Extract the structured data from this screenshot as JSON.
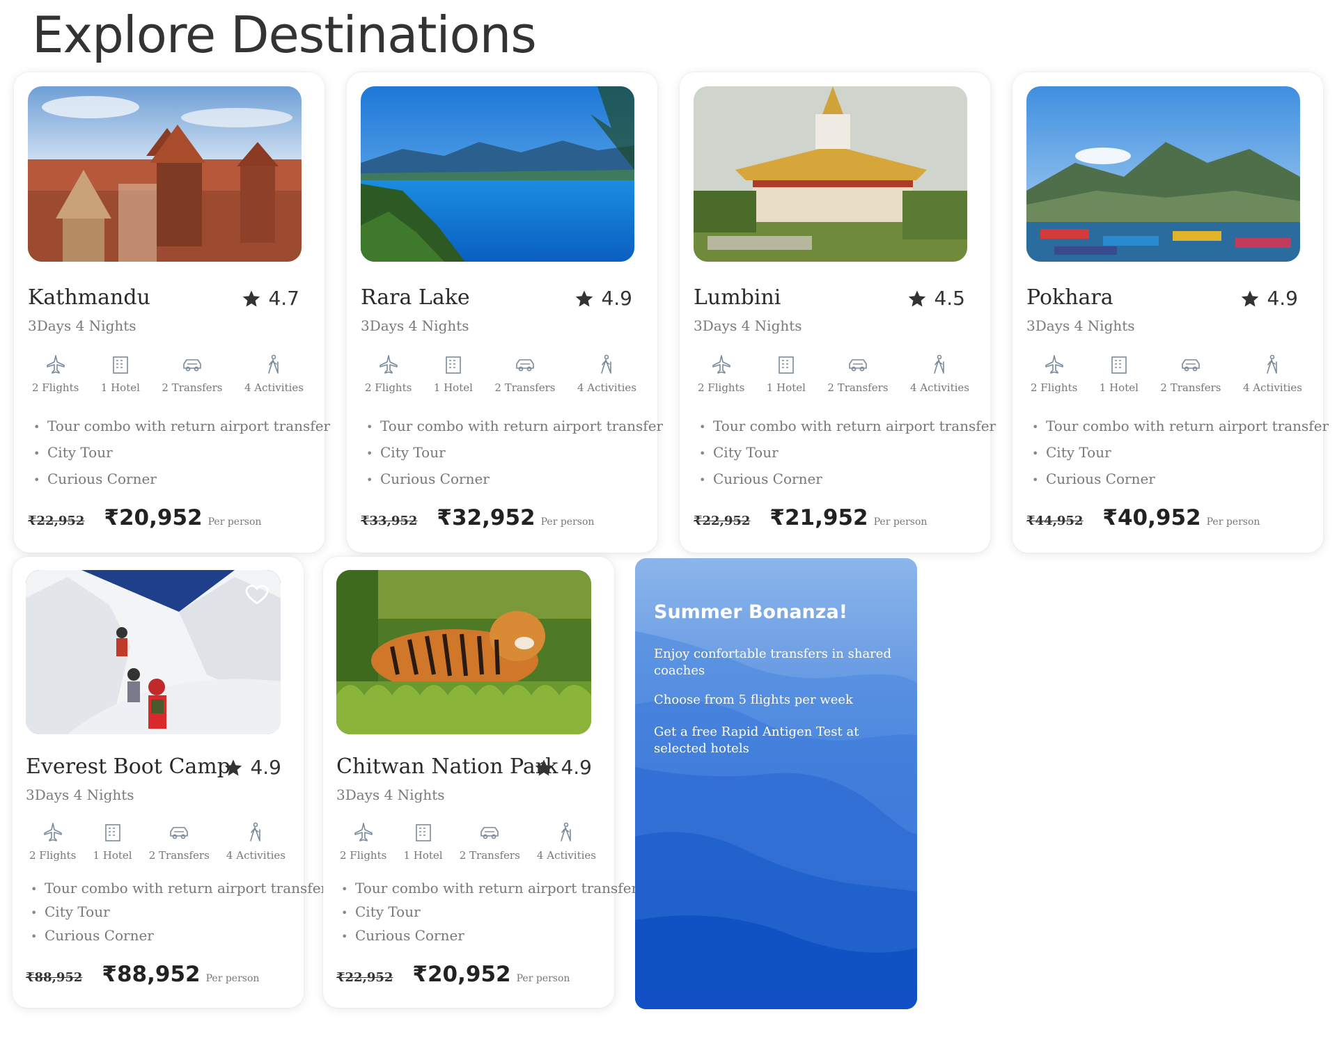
{
  "page": {
    "title": "Explore Destinations"
  },
  "common": {
    "duration": "3Days  4  Nights",
    "features": [
      "2 Flights",
      "1 Hotel",
      "2 Transfers",
      "4 Activities"
    ],
    "highlights": [
      "Tour combo with return airport transfer",
      "City Tour",
      "Curious Corner"
    ],
    "per_person": "Per  person"
  },
  "cards": [
    {
      "name": "Kathmandu",
      "rating": "4.7",
      "old_price": "₹22,952",
      "price": "₹20,952"
    },
    {
      "name": "Rara  Lake",
      "rating": "4.9",
      "old_price": "₹33,952",
      "price": "₹32,952"
    },
    {
      "name": "Lumbini",
      "rating": "4.5",
      "old_price": "₹22,952",
      "price": "₹21,952"
    },
    {
      "name": "Pokhara",
      "rating": "4.9",
      "old_price": "₹44,952",
      "price": "₹40,952"
    },
    {
      "name": "Everest  Boot  Camp",
      "rating": "4.9",
      "old_price": "₹88,952",
      "price": "₹88,952"
    },
    {
      "name": "Chitwan  Nation  Park",
      "rating": "4.9",
      "old_price": "₹22,952",
      "price": "₹20,952"
    }
  ],
  "promo": {
    "title": "Summer Bonanza!",
    "lines": [
      "Enjoy  confortable  transfers  in  shared coaches",
      "Choose  from  5  flights  per  week",
      "Get  a  free  Rapid  Antigen  Test  at selected  hotels"
    ]
  },
  "icons": {
    "rating": "star-icon",
    "features": [
      "plane-icon",
      "hotel-icon",
      "car-icon",
      "hiker-icon"
    ],
    "favorite": "heart-icon"
  },
  "colors": {
    "promo_top": "#8bb6ea",
    "promo_bottom": "#0a4fd0",
    "text_muted": "#777777"
  }
}
